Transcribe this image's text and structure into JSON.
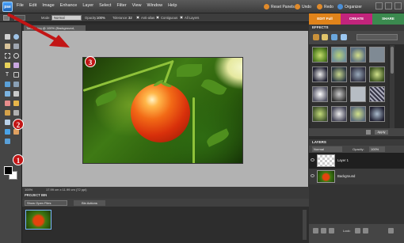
{
  "app": {
    "logo_text": "pse"
  },
  "menu": [
    "File",
    "Edit",
    "Image",
    "Enhance",
    "Layer",
    "Select",
    "Filter",
    "View",
    "Window",
    "Help"
  ],
  "top_right": {
    "reset_panels": "Reset Panels",
    "undo": "Undo",
    "redo": "Redo",
    "organizer": "Organizer"
  },
  "options_bar": {
    "mode_label": "Mode:",
    "mode_value": "Normal",
    "opacity_label": "Opacity:",
    "opacity_value": "100%",
    "tolerance_label": "Tolerance:",
    "tolerance_value": "32",
    "antialias_label": "Anti-alias",
    "contiguous_label": "Contiguous",
    "all_layers_label": "All Layers"
  },
  "mode_tabs": [
    {
      "label": "EDIT Full",
      "color": "#e0831a"
    },
    {
      "label": "CREATE",
      "color": "#c2247c"
    },
    {
      "label": "SHARE",
      "color": "#3b8a4f"
    }
  ],
  "document": {
    "tab_label": "Tomato.jpg @ 100% (Background, RGB/8)",
    "zoom": "100%",
    "doc_size": "17.99 cm x 11.99 cm (72 ppi)"
  },
  "project_bin": {
    "title": "PROJECT BIN",
    "show_select": "Show Open Files",
    "bin_actions": "Bin Actions"
  },
  "effects": {
    "title": "EFFECTS",
    "apply_label": "Apply"
  },
  "layers": {
    "title": "LAYERS",
    "blend_mode": "Normal",
    "opacity_label": "Opacity:",
    "opacity_value": "100%",
    "lock_label": "Lock:",
    "items": [
      {
        "name": "Layer 1"
      },
      {
        "name": "Background"
      }
    ]
  },
  "callouts": {
    "c1": "1",
    "c2": "2",
    "c3": "3"
  },
  "colors": {
    "accent_red": "#c21515",
    "edit_tab": "#e0831a",
    "create_tab": "#c2247c",
    "share_tab": "#3b8a4f"
  }
}
